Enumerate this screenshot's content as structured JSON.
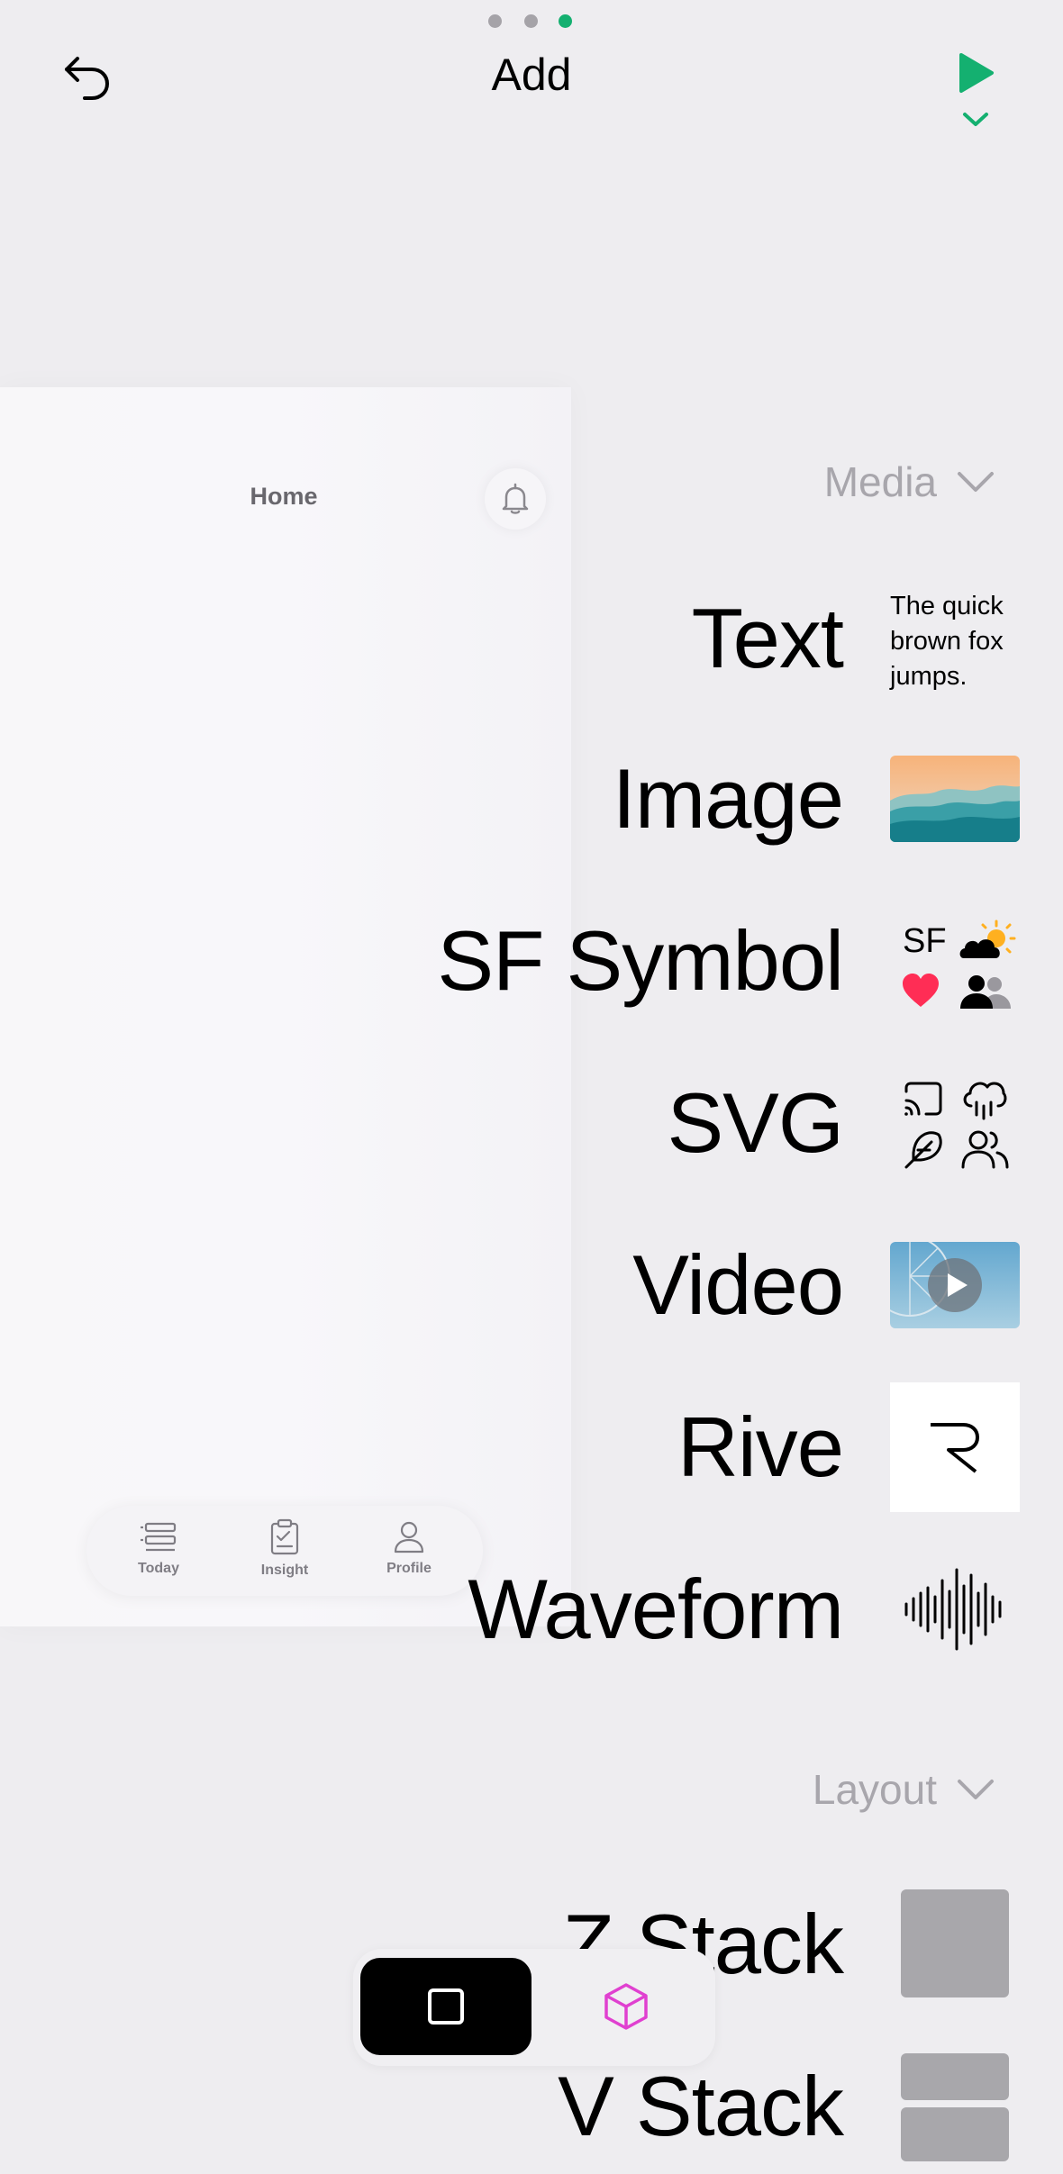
{
  "page_indicator": {
    "count": 3,
    "active_index": 2
  },
  "header": {
    "title": "Add",
    "undo_icon": "undo-arrow-icon",
    "play_icon": "play-icon",
    "chevron_icon": "chevron-down-icon"
  },
  "colors": {
    "accent": "#14b070",
    "background": "#eeedf0",
    "muted": "#a8a6ac",
    "heart": "#ff2d55",
    "sun": "#ffb020",
    "magenta": "#e040d0"
  },
  "preview": {
    "title": "Home",
    "bell_icon": "bell-icon",
    "tabs": [
      {
        "label": "Today",
        "icon": "today-list-icon"
      },
      {
        "label": "Insight",
        "icon": "clipboard-check-icon"
      },
      {
        "label": "Profile",
        "icon": "person-icon"
      }
    ]
  },
  "sections": {
    "media": {
      "label": "Media",
      "items": [
        {
          "label": "Text",
          "thumb_text": "The quick brown fox jumps."
        },
        {
          "label": "Image"
        },
        {
          "label": "SF Symbol",
          "thumb_text": "SF"
        },
        {
          "label": "SVG"
        },
        {
          "label": "Video"
        },
        {
          "label": "Rive"
        },
        {
          "label": "Waveform"
        }
      ]
    },
    "layout": {
      "label": "Layout",
      "items": [
        {
          "label": "Z Stack"
        },
        {
          "label": "V Stack"
        }
      ]
    }
  },
  "toolbar": {
    "items": [
      {
        "icon": "square-icon",
        "active": true
      },
      {
        "icon": "cube-icon",
        "active": false
      }
    ]
  }
}
